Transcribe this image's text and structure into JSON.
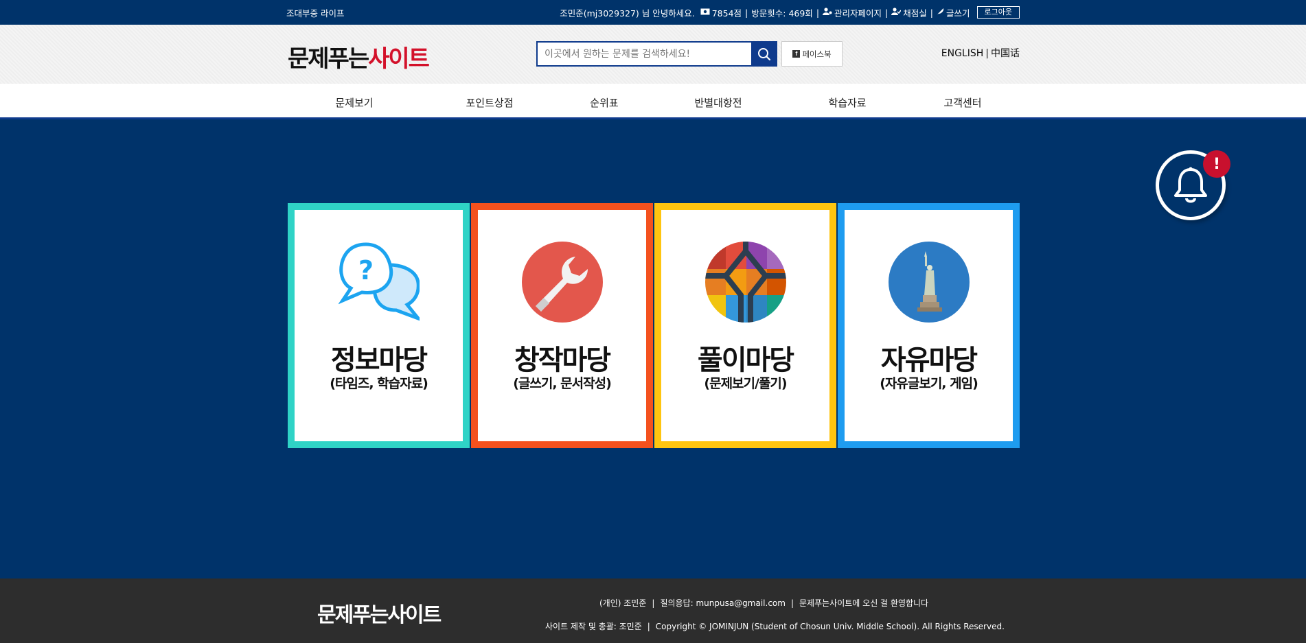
{
  "topbar": {
    "site_label": "조대부중 라이프",
    "greeting": "조민준(mj3029327) 님 안녕하세요.",
    "points": "7854점",
    "visits": "방문횟수: 469회",
    "admin_link": "관리자페이지",
    "grading_link": "채점실",
    "write_link": "글쓰기",
    "logout_label": "로그아웃"
  },
  "header": {
    "logo_black": "문제푸는",
    "logo_red": "사이트",
    "search_placeholder": "이곳에서 원하는 문제를 검색하세요!",
    "facebook_label": "페이스북",
    "lang_english": "ENGLISH",
    "lang_chinese": "中国话"
  },
  "nav": {
    "items": [
      {
        "label": "문제보기"
      },
      {
        "label": "포인트상점"
      },
      {
        "label": "순위표"
      },
      {
        "label": "반별대항전"
      },
      {
        "label": "학습자료"
      },
      {
        "label": "고객센터"
      }
    ]
  },
  "cards": [
    {
      "title": "정보마당",
      "subtitle": "(타임즈, 학습자료)",
      "border_color": "#2fd3c6"
    },
    {
      "title": "창작마당",
      "subtitle": "(글쓰기, 문서작성)",
      "border_color": "#f4511e"
    },
    {
      "title": "풀이마당",
      "subtitle": "(문제보기/풀기)",
      "border_color": "#ffc510"
    },
    {
      "title": "자유마당",
      "subtitle": "(자유글보기, 게임)",
      "border_color": "#1e9cf0"
    }
  ],
  "notification": {
    "badge": "!"
  },
  "footer": {
    "logo": "문제푸는사이트",
    "owner": "(개인) 조민준",
    "contact": "질의응답: munpusa@gmail.com",
    "welcome": "문제푸는사이트에 오신 걸 환영합니다",
    "producer": "사이트 제작 및 총괄: 조민준",
    "copyright": "Copyright © JOMINJUN (Student of Chosun Univ. Middle School). All Rights Reserved."
  },
  "colors": {
    "primary": "#00336a",
    "accent_red": "#d3112a",
    "badge_red": "#c8102e",
    "footer_bg": "#2d2d2d"
  }
}
